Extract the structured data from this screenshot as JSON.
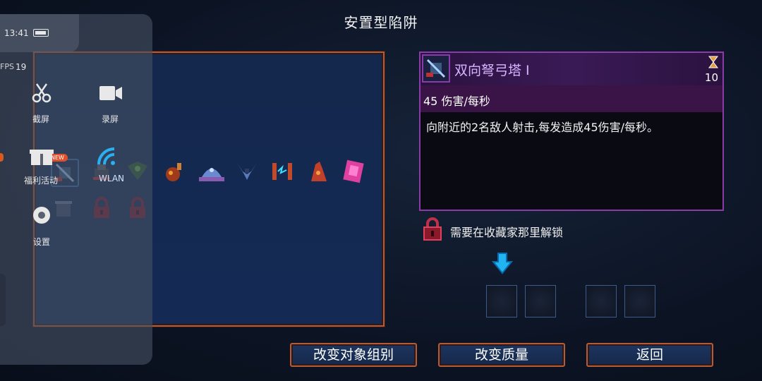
{
  "screen_title": "安置型陷阱",
  "selected_item": {
    "name": "双向弩弓塔 I",
    "timer": "10",
    "dps": "45 伤害/每秒",
    "description": "向附近的2名敌人射击,每发造成45伤害/每秒。"
  },
  "unlock_hint": "需要在收藏家那里解锁",
  "buttons": {
    "change_group": "改变对象组别",
    "change_quality": "改变质量",
    "back": "返回"
  },
  "items": [
    {
      "icon": "crossbow-turret-icon",
      "selected": true
    },
    {
      "icon": "saw-turret-icon"
    },
    {
      "icon": "vine-trap-icon"
    },
    {
      "icon": "fire-bomb-icon"
    },
    {
      "icon": "ice-dome-icon"
    },
    {
      "icon": "double-blade-icon"
    },
    {
      "icon": "lightning-trap-icon"
    },
    {
      "icon": "flame-totem-icon"
    },
    {
      "icon": "pink-card-icon"
    },
    {
      "icon": "tesla-turret-icon"
    },
    {
      "icon": "locked-padlock-icon",
      "locked": true
    },
    {
      "icon": "locked-padlock-icon",
      "locked": true
    }
  ],
  "system_overlay": {
    "time": "13:41",
    "fps_label": "FPS",
    "fps_value": "19",
    "screenshot_label": "截屏",
    "record_label": "录屏",
    "welfare_label": "福利活动",
    "welfare_badge": "NEW",
    "wlan_label": "WLAN",
    "settings_label": "设置"
  },
  "colors": {
    "accent_orange": "#b85a35",
    "panel_blue": "#142a55",
    "purple_border": "#8a3ba8",
    "lock_red": "#c0304a",
    "arrow_blue": "#22b4f0"
  }
}
